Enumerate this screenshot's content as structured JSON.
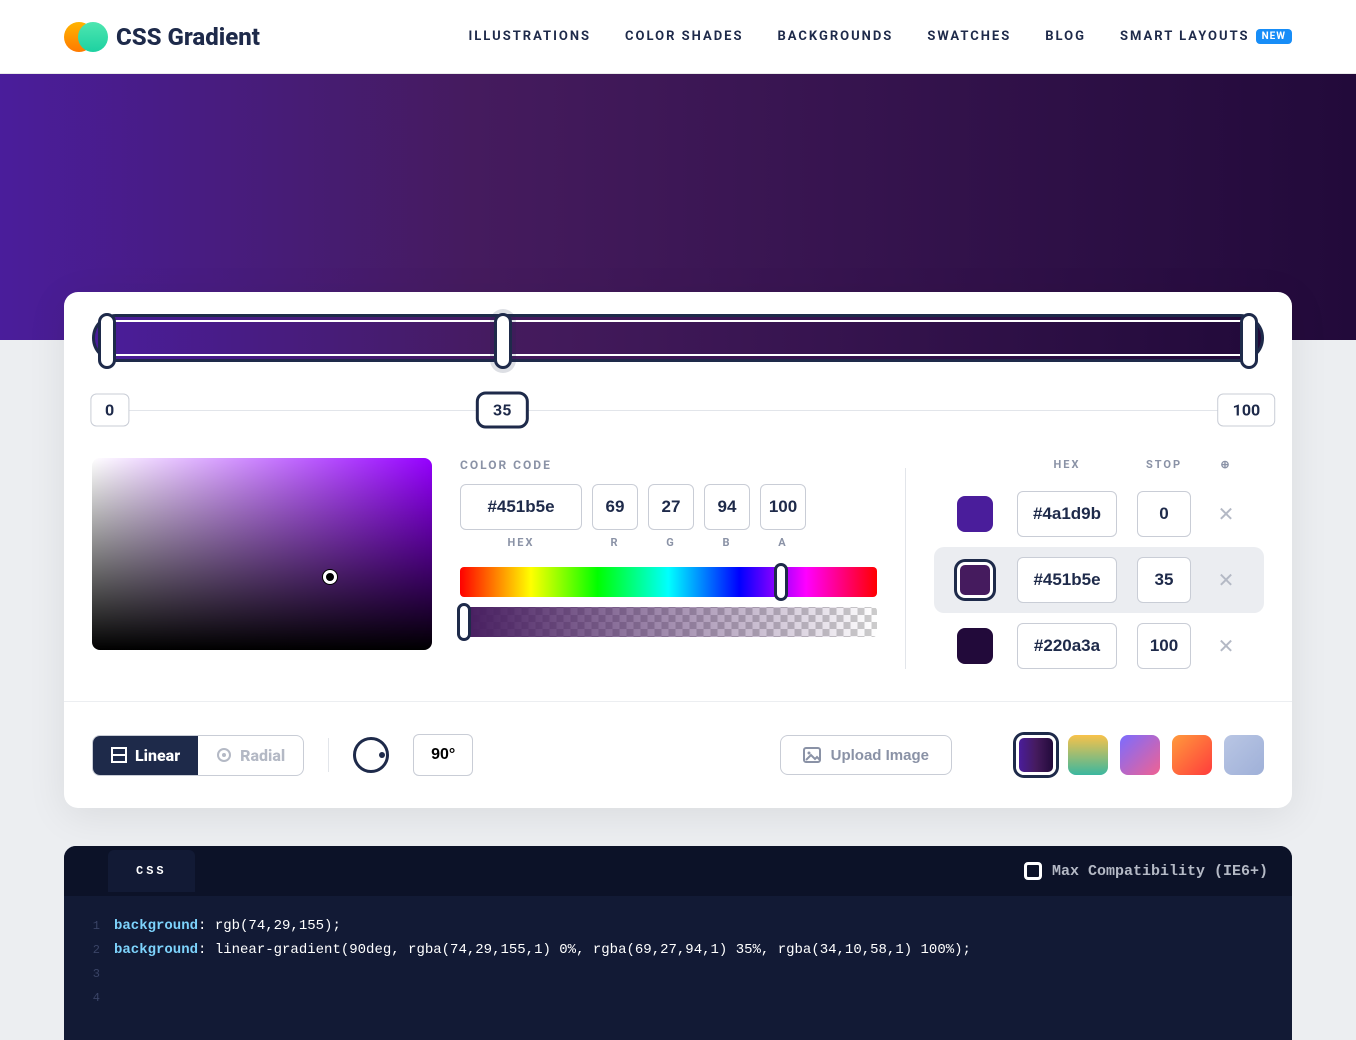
{
  "header": {
    "brand": "CSS Gradient",
    "nav": [
      "ILLUSTRATIONS",
      "COLOR SHADES",
      "BACKGROUNDS",
      "SWATCHES",
      "BLOG",
      "SMART LAYOUTS"
    ],
    "new_badge": "NEW"
  },
  "gradient": {
    "css": "linear-gradient(90deg, rgba(74,29,155,1) 0%, rgba(69,27,94,1) 35%, rgba(34,10,58,1) 100%)",
    "angle": "90°",
    "type": "Linear"
  },
  "stops_track": [
    {
      "pos": 0,
      "active": false
    },
    {
      "pos": 35,
      "active": true
    },
    {
      "pos": 100,
      "active": false
    }
  ],
  "color_code": {
    "label": "COLOR CODE",
    "hex": "#451b5e",
    "r": "69",
    "g": "27",
    "b": "94",
    "a": "100",
    "labels": {
      "hex": "HEX",
      "r": "R",
      "g": "G",
      "b": "B",
      "a": "A"
    }
  },
  "stops_list": {
    "head": {
      "hex": "HEX",
      "stop": "STOP"
    },
    "items": [
      {
        "color": "#4a1d9b",
        "hex": "#4a1d9b",
        "stop": "0",
        "active": false
      },
      {
        "color": "#451b5e",
        "hex": "#451b5e",
        "stop": "35",
        "active": true
      },
      {
        "color": "#220a3a",
        "hex": "#220a3a",
        "stop": "100",
        "active": false
      }
    ]
  },
  "bottom": {
    "linear": "Linear",
    "radial": "Radial",
    "upload": "Upload Image",
    "presets": [
      "linear-gradient(90deg,#4a1d9b,#451b5e,#220a3a)",
      "linear-gradient(180deg,#f8c24a,#3bb79f)",
      "linear-gradient(135deg,#7b6cff,#f06292)",
      "linear-gradient(135deg,#ff9a3c,#ff3c3c)",
      "linear-gradient(135deg,#b9c6e4,#9fb0d8)"
    ]
  },
  "code_panel": {
    "tab": "CSS",
    "compat": "Max Compatibility (IE6+)",
    "line1_prop": "background",
    "line1_val": ": rgb(74,29,155);",
    "line2_prop": "background",
    "line2_val": ": linear-gradient(90deg, rgba(74,29,155,1) 0%, rgba(69,27,94,1) 35%, rgba(34,10,58,1) 100%);"
  }
}
